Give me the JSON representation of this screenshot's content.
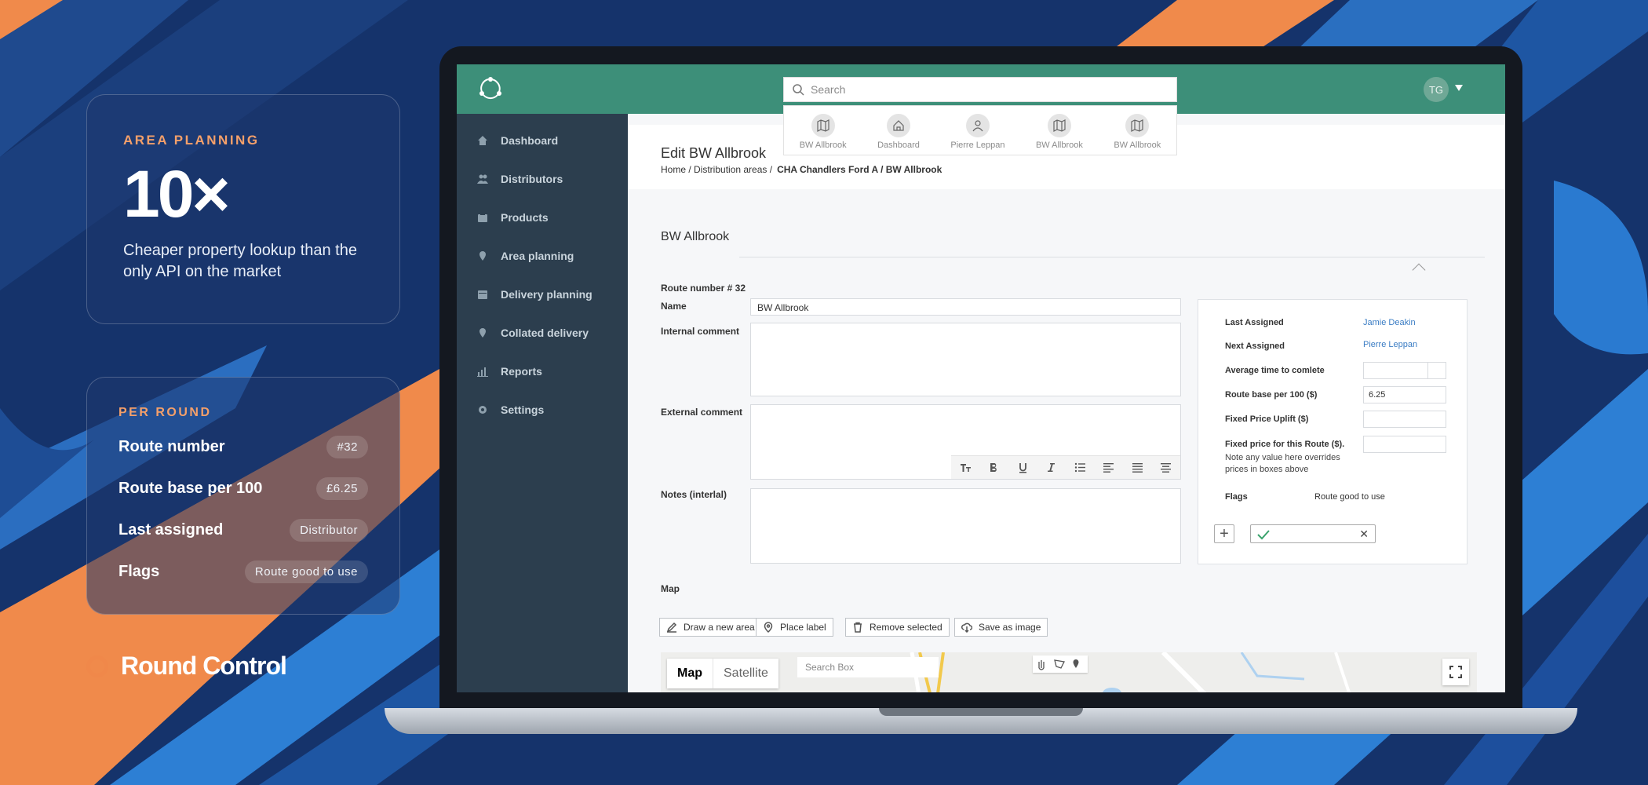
{
  "promo": {
    "area_planning": {
      "eyebrow": "AREA PLANNING",
      "stat": "10×",
      "description": "Cheaper property lookup than the only API on the market"
    },
    "per_round": {
      "eyebrow": "PER ROUND",
      "rows": [
        {
          "label": "Route number",
          "value": "#32"
        },
        {
          "label": "Route base per 100",
          "value": "£6.25"
        },
        {
          "label": "Last assigned",
          "value": "Distributor"
        },
        {
          "label": "Flags",
          "value": "Route good to use"
        }
      ]
    },
    "brand": "Round Control"
  },
  "colors": {
    "accent_orange": "#f0884a",
    "topbar_green": "#3d8f79",
    "sidebar": "#2c3e4e",
    "link_blue": "#3b7dc4"
  },
  "app": {
    "search": {
      "placeholder": "Search"
    },
    "suggestions": [
      {
        "icon": "map-icon",
        "label": "BW Allbrook"
      },
      {
        "icon": "home-icon",
        "label": "Dashboard"
      },
      {
        "icon": "user-icon",
        "label": "Pierre Leppan"
      },
      {
        "icon": "map-icon",
        "label": "BW Allbrook"
      },
      {
        "icon": "map-icon",
        "label": "BW Allbrook"
      }
    ],
    "user_initials": "TG",
    "sidebar": [
      {
        "icon": "home-icon",
        "label": "Dashboard"
      },
      {
        "icon": "users-icon",
        "label": "Distributors"
      },
      {
        "icon": "box-icon",
        "label": "Products"
      },
      {
        "icon": "pin-icon",
        "label": "Area planning"
      },
      {
        "icon": "calendar-icon",
        "label": "Delivery planning"
      },
      {
        "icon": "pin-icon",
        "label": "Collated delivery"
      },
      {
        "icon": "chart-icon",
        "label": "Reports"
      },
      {
        "icon": "gear-icon",
        "label": "Settings"
      }
    ],
    "page": {
      "title": "Edit BW Allbrook",
      "breadcrumb_prefix": "Home / Distribution areas /",
      "breadcrumb_current": "CHA Chandlers Ford A / BW Allbrook",
      "section_title": "BW Allbrook",
      "route_number": "Route number # 32"
    },
    "form": {
      "name_label": "Name",
      "name_value": "BW Allbrook",
      "internal_label": "Internal comment",
      "external_label": "External  comment",
      "notes_label": "Notes (interlal)"
    },
    "panel": {
      "last_assigned_label": "Last Assigned",
      "last_assigned_value": "Jamie Deakin",
      "next_assigned_label": "Next Assigned",
      "next_assigned_value": "Pierre Leppan",
      "avg_time_label": "Average time to comlete",
      "base_label": "Route base per 100 ($)",
      "base_value": "6.25",
      "uplift_label": "Fixed Price Uplift ($)",
      "fixed_label": "Fixed price for this  Route ($).",
      "fixed_note": "Note any value here overrides prices in boxes above",
      "flags_label": "Flags",
      "flags_value": "Route good to use"
    },
    "map": {
      "label": "Map",
      "buttons": [
        "Draw a new area",
        "Place label",
        "Remove selected",
        "Save as image"
      ],
      "type_map": "Map",
      "type_satellite": "Satellite",
      "search_placeholder": "Search Box"
    }
  }
}
